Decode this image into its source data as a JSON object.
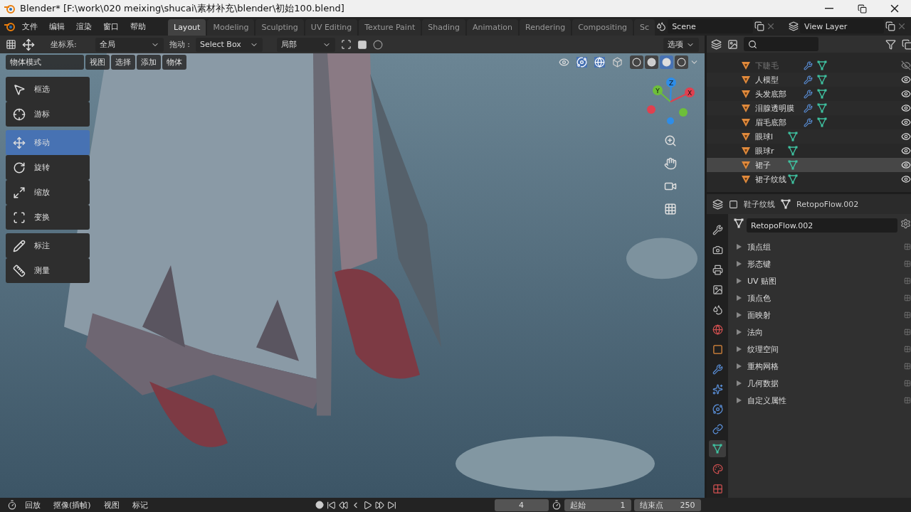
{
  "window": {
    "title": "Blender* [F:\\work\\020 meixing\\shucai\\素材补充\\blender\\初始100.blend]"
  },
  "menu": [
    "文件",
    "编辑",
    "渲染",
    "窗口",
    "帮助"
  ],
  "workspaces": [
    {
      "label": "Layout",
      "selected": true
    },
    {
      "label": "Modeling",
      "selected": false
    },
    {
      "label": "Sculpting",
      "selected": false
    },
    {
      "label": "UV Editing",
      "selected": false
    },
    {
      "label": "Texture Paint",
      "selected": false
    },
    {
      "label": "Shading",
      "selected": false
    },
    {
      "label": "Animation",
      "selected": false
    },
    {
      "label": "Rendering",
      "selected": false
    },
    {
      "label": "Compositing",
      "selected": false
    },
    {
      "label": "Sc",
      "selected": false
    }
  ],
  "scene": "Scene",
  "view_layer": "View Layer",
  "tool_settings": {
    "orientation_label": "坐标系:",
    "orientation": "全局",
    "drag_label": "拖动 :",
    "drag": "Select Box",
    "pivot": "局部",
    "options": "选项"
  },
  "viewport_header": {
    "mode": "物体模式",
    "menus": [
      "视图",
      "选择",
      "添加",
      "物体"
    ],
    "shading": [
      {
        "kind": "wireframe",
        "selected": false
      },
      {
        "kind": "solid",
        "selected": false
      },
      {
        "kind": "material",
        "selected": true
      },
      {
        "kind": "rendered",
        "selected": false
      }
    ]
  },
  "tools": [
    {
      "label": "框选",
      "kind": "select",
      "selected": false
    },
    {
      "label": "游标",
      "kind": "cursor",
      "selected": false
    },
    {
      "label": "移动",
      "kind": "move",
      "selected": true
    },
    {
      "label": "旋转",
      "kind": "rotate",
      "selected": false
    },
    {
      "label": "缩放",
      "kind": "scale",
      "selected": false
    },
    {
      "label": "变换",
      "kind": "transform",
      "selected": false
    },
    {
      "label": "标注",
      "kind": "annotate",
      "selected": false
    },
    {
      "label": "测量",
      "kind": "measure",
      "selected": false
    }
  ],
  "gizmo_axes": [
    "Z",
    "Y",
    "X"
  ],
  "outliner": {
    "rows": [
      {
        "name": "下睫毛",
        "modifier": true,
        "visible": false,
        "selected": false
      },
      {
        "name": "人模型",
        "modifier": true,
        "visible": true,
        "selected": false
      },
      {
        "name": "头发底部",
        "modifier": true,
        "visible": true,
        "selected": false
      },
      {
        "name": "泪腺透明膜",
        "modifier": true,
        "visible": true,
        "selected": false
      },
      {
        "name": "眉毛底部",
        "modifier": true,
        "visible": true,
        "selected": false
      },
      {
        "name": "眼球l",
        "modifier": false,
        "visible": true,
        "selected": false
      },
      {
        "name": "眼球r",
        "modifier": false,
        "visible": true,
        "selected": false
      },
      {
        "name": "裙子",
        "modifier": false,
        "visible": true,
        "selected": true
      },
      {
        "name": "裙子纹线",
        "modifier": false,
        "visible": true,
        "selected": false
      }
    ]
  },
  "properties": {
    "object": "鞋子纹线",
    "mesh": "RetopoFlow.002",
    "datablock": "RetopoFlow.002",
    "tabs": [
      {
        "kind": "tool",
        "selected": false
      },
      {
        "kind": "render",
        "selected": false
      },
      {
        "kind": "output",
        "selected": false
      },
      {
        "kind": "view-layer",
        "selected": false
      },
      {
        "kind": "scene",
        "selected": false
      },
      {
        "kind": "world",
        "selected": false
      },
      {
        "kind": "object",
        "selected": false
      },
      {
        "kind": "modifier",
        "selected": false
      },
      {
        "kind": "particles",
        "selected": false
      },
      {
        "kind": "physics",
        "selected": false
      },
      {
        "kind": "constraints",
        "selected": false
      },
      {
        "kind": "data",
        "selected": true
      },
      {
        "kind": "material",
        "selected": false
      },
      {
        "kind": "texture",
        "selected": false
      }
    ],
    "panels": [
      "顶点组",
      "形态键",
      "UV 贴图",
      "顶点色",
      "面映射",
      "法向",
      "纹理空间",
      "重构网格",
      "几何数据",
      "自定义属性"
    ]
  },
  "timeline": {
    "menus": [
      "回放",
      "抠像(插帧)",
      "视图",
      "标记"
    ],
    "frame": "4",
    "start_label": "起始",
    "start": "1",
    "end_label": "结束点",
    "end": "250"
  }
}
